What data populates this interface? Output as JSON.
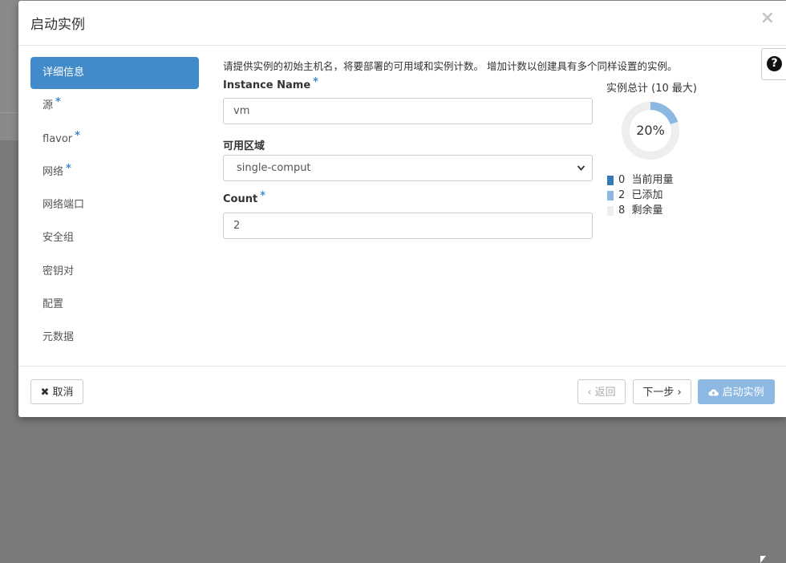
{
  "modal": {
    "title": "启动实例",
    "close_icon": "×",
    "help_icon": "?"
  },
  "nav": {
    "items": [
      {
        "label": "详细信息",
        "required": false,
        "active": true
      },
      {
        "label": "源",
        "required": true
      },
      {
        "label": "flavor",
        "required": true
      },
      {
        "label": "网络",
        "required": true
      },
      {
        "label": "网络端口",
        "required": false
      },
      {
        "label": "安全组",
        "required": false
      },
      {
        "label": "密钥对",
        "required": false
      },
      {
        "label": "配置",
        "required": false
      },
      {
        "label": "元数据",
        "required": false
      }
    ],
    "required_marker": "*"
  },
  "form": {
    "description": "请提供实例的初始主机名，将要部署的可用域和实例计数。 增加计数以创建具有多个同样设置的实例。",
    "instance_name_label": "Instance Name",
    "instance_name_value": "vm",
    "zone_label": "可用区域",
    "zone_value": "single-comput",
    "count_label": "Count",
    "count_value": "2"
  },
  "quota": {
    "title": "实例总计 (10 最大)",
    "percent_label": "20%",
    "percent": 20,
    "legend": [
      {
        "value": "0",
        "label": "当前用量",
        "color": "#337ab7"
      },
      {
        "value": "2",
        "label": "已添加",
        "color": "#8db8e2"
      },
      {
        "value": "8",
        "label": "剩余量",
        "color": "#eeeeee"
      }
    ]
  },
  "footer": {
    "cancel_label": "✖ 取消",
    "back_label": "‹ 返回",
    "next_label": "下一步 ›",
    "launch_label": "启动实例",
    "launch_icon": "cloud-upload-icon"
  }
}
